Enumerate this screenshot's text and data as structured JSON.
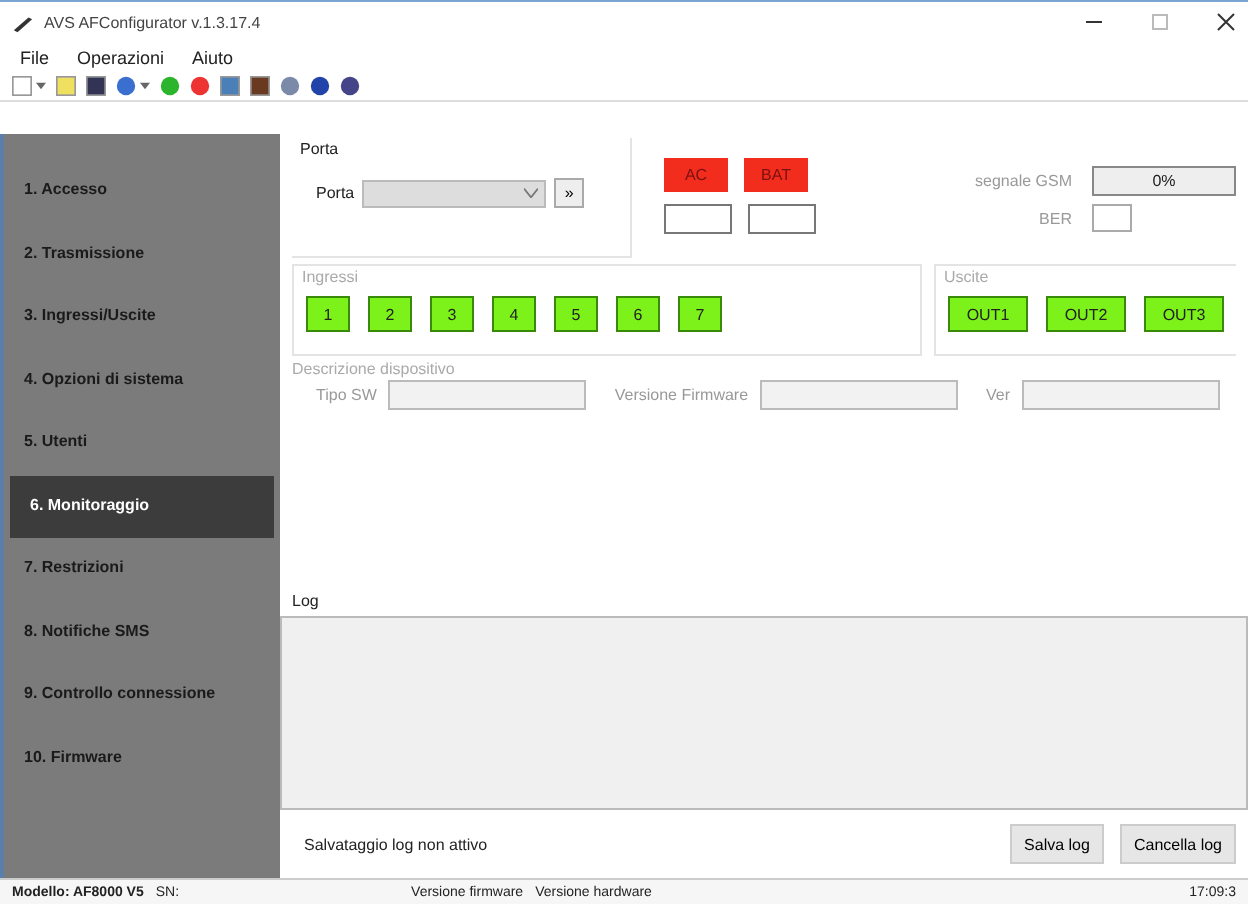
{
  "window": {
    "title": "AVS AFConfigurator v.1.3.17.4"
  },
  "menu": [
    "File",
    "Operazioni",
    "Aiuto"
  ],
  "sidebar": {
    "items": [
      {
        "label": "1. Accesso",
        "selected": false
      },
      {
        "label": "2. Trasmissione",
        "selected": false
      },
      {
        "label": "3. Ingressi/Uscite",
        "selected": false
      },
      {
        "label": "4. Opzioni di sistema",
        "selected": false
      },
      {
        "label": "5. Utenti",
        "selected": false
      },
      {
        "label": "6. Monitoraggio",
        "selected": true
      },
      {
        "label": "7. Restrizioni",
        "selected": false
      },
      {
        "label": "8. Notifiche SMS",
        "selected": false
      },
      {
        "label": "9. Controllo connessione",
        "selected": false
      },
      {
        "label": "10. Firmware",
        "selected": false
      }
    ]
  },
  "porta": {
    "title": "Porta",
    "label": "Porta",
    "button": "»"
  },
  "power": [
    {
      "label": "AC",
      "on": true
    },
    {
      "label": "BAT",
      "on": true
    }
  ],
  "gsm": {
    "signal_label": "segnale GSM",
    "signal_value": "0%",
    "ber_label": "BER"
  },
  "ingressi": {
    "title": "Ingressi",
    "items": [
      {
        "label": "1",
        "on": true
      },
      {
        "label": "2",
        "on": true
      },
      {
        "label": "3",
        "on": true
      },
      {
        "label": "4",
        "on": true
      },
      {
        "label": "5",
        "on": true
      },
      {
        "label": "6",
        "on": true
      },
      {
        "label": "7",
        "on": true
      }
    ]
  },
  "uscite": {
    "title": "Uscite",
    "items": [
      {
        "label": "OUT1",
        "on": true
      },
      {
        "label": "OUT2",
        "on": true
      },
      {
        "label": "OUT3",
        "on": true
      }
    ]
  },
  "descrizione": {
    "title": "Descrizione dispositivo",
    "fields": [
      "Tipo SW",
      "Versione Firmware",
      "Ver"
    ]
  },
  "log": {
    "title": "Log",
    "status": "Salvataggio log non attivo",
    "buttons": [
      "Salva log",
      "Cancella log"
    ]
  },
  "status_bar": [
    "Modello: AF8000 V5",
    "SN:",
    "Versione firmware",
    "Versione hardware",
    "17:09:3"
  ]
}
